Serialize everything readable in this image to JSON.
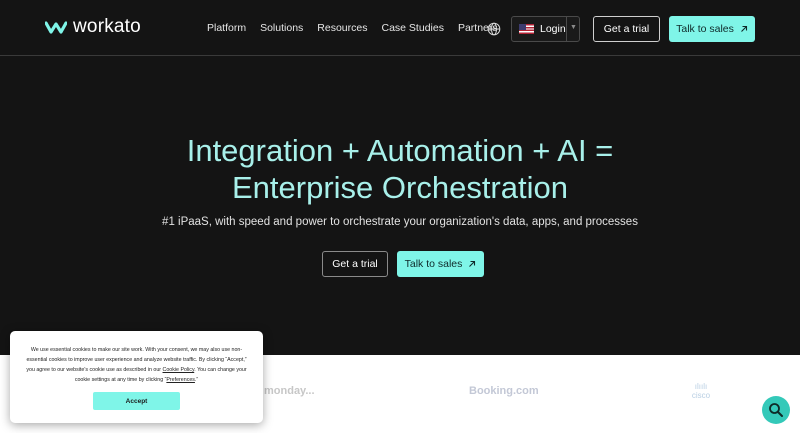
{
  "header": {
    "brand": "workato",
    "nav": [
      "Platform",
      "Solutions",
      "Resources",
      "Case Studies",
      "Partners"
    ],
    "login_label": "Login",
    "trial_label": "Get a trial",
    "sales_label": "Talk to sales"
  },
  "hero": {
    "title_line1": "Integration + Automation + AI =",
    "title_line2": "Enterprise Orchestration",
    "subtitle": "#1 iPaaS, with speed and power to orchestrate your organization's data, apps, and processes",
    "trial_label": "Get a trial",
    "sales_label": "Talk to sales"
  },
  "logos": {
    "monday": "monday...",
    "booking": "Booking.com",
    "cisco_top": "ılıılı",
    "cisco": "cisco"
  },
  "cookie": {
    "text_a": "We use essential cookies to make our site work. With your consent, we may also use non-essential cookies to improve user experience and analyze website traffic. By clicking “Accept,” you agree to our website's cookie use as described in our ",
    "policy_link": "Cookie Policy",
    "text_b": ". You can change your cookie settings at any time by clicking “",
    "preferences_link": "Preferences",
    "text_c": ".”",
    "accept_label": "Accept"
  },
  "colors": {
    "background": "#141414",
    "accent": "#7ff5e8",
    "hero_title": "#a8f0ea",
    "fab": "#34c9b9"
  },
  "icons": {
    "globe": "globe-icon",
    "arrow": "arrow-up-right-icon",
    "caret": "chevron-down-icon",
    "search": "search-icon"
  }
}
